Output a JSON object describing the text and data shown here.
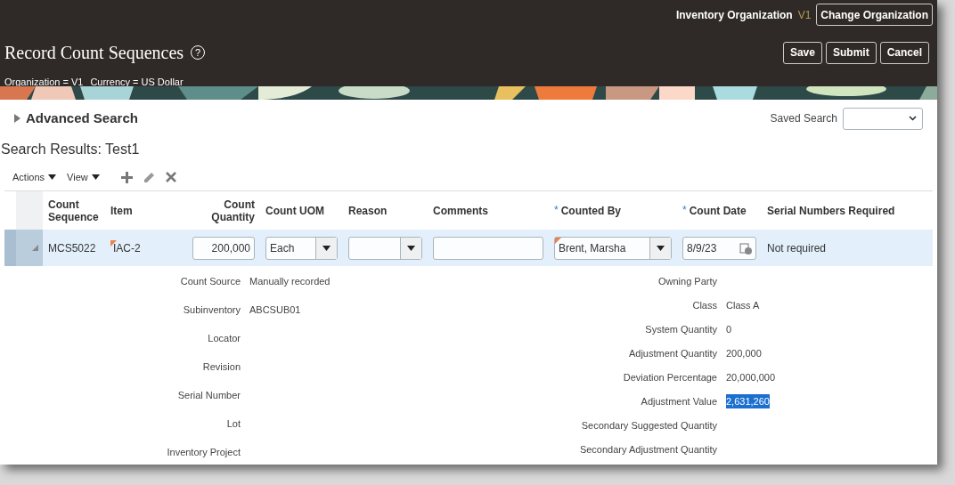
{
  "header": {
    "org_label": "Inventory Organization",
    "org_value": "V1",
    "change_button": "Change Organization",
    "title": "Record Count Sequences",
    "help": "?",
    "context": [
      "Organization = V1",
      "Currency = US Dollar"
    ],
    "buttons": [
      "Save",
      "Submit",
      "Cancel"
    ],
    "banner": {
      "kind": "picture"
    }
  },
  "search": {
    "label": "Advanced Search",
    "expanded": false,
    "saved_search_label": "Saved Search"
  },
  "results": {
    "title": "Search Results: Test1",
    "menus": [
      "Actions",
      "View"
    ],
    "required_mark": "*",
    "columns": [
      {
        "label": "Count Sequence",
        "required": false
      },
      {
        "label": "Item",
        "required": false
      },
      {
        "label": "Count Quantity",
        "required": false
      },
      {
        "label": "Count UOM",
        "required": false
      },
      {
        "label": "Reason",
        "required": false
      },
      {
        "label": "Comments",
        "required": false
      },
      {
        "label": "Counted By",
        "required": true
      },
      {
        "label": "Count Date",
        "required": true
      },
      {
        "label": "Serial Numbers Required",
        "required": false
      }
    ],
    "rows": [
      {
        "selected": true,
        "expanded": true,
        "cells": [
          {
            "kind": "text",
            "value": "MCS5022"
          },
          {
            "kind": "flagged",
            "value": "IAC-2"
          },
          {
            "kind": "number",
            "value": "200,000"
          },
          {
            "kind": "select",
            "value": "Each"
          },
          {
            "kind": "select"
          },
          {
            "kind": "input"
          },
          {
            "kind": "select",
            "value": "Brent, Marsha",
            "flagged": true
          },
          {
            "kind": "date",
            "value": "8/9/23"
          },
          {
            "kind": "text",
            "value": "Not required"
          }
        ]
      }
    ]
  },
  "details": {
    "left": [
      {
        "label": "Count Source",
        "value": "Manually recorded"
      },
      {
        "label": "Subinventory",
        "value": "ABCSUB01"
      },
      {
        "label": "Locator"
      },
      {
        "label": "Revision"
      },
      {
        "label": "Serial Number"
      },
      {
        "label": "Lot"
      },
      {
        "label": "Inventory Project"
      }
    ],
    "right": [
      {
        "label": "Owning Party"
      },
      {
        "label": "Class",
        "value": "Class A"
      },
      {
        "label": "System Quantity",
        "value": "0"
      },
      {
        "label": "Adjustment Quantity",
        "value": "200,000"
      },
      {
        "label": "Deviation Percentage",
        "value": "20,000,000"
      },
      {
        "label": "Adjustment Value",
        "value": "2,631,260",
        "highlighted": true
      },
      {
        "label": "Secondary Suggested Quantity"
      },
      {
        "label": "Secondary Adjustment Quantity"
      }
    ]
  }
}
